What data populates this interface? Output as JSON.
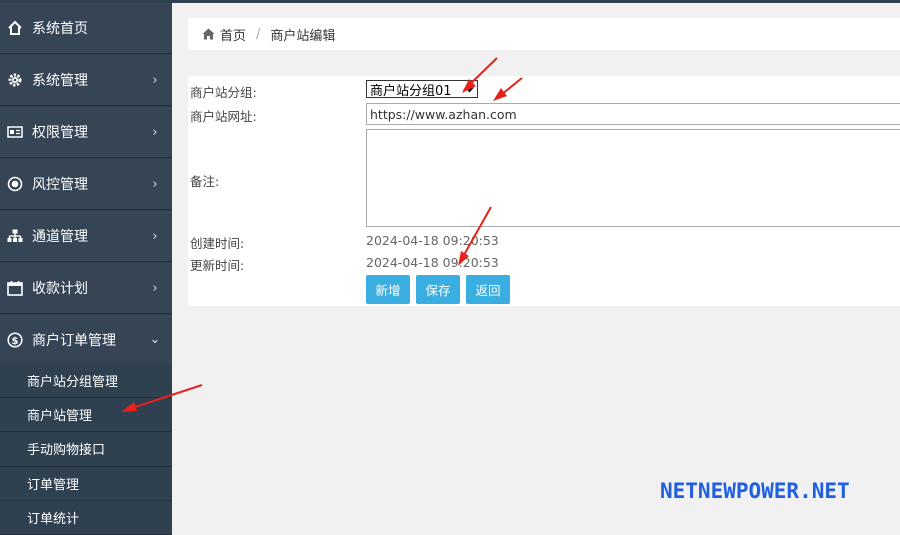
{
  "sidebar": {
    "items": [
      {
        "label": "系统首页",
        "icon": "home-icon",
        "arrow": ""
      },
      {
        "label": "系统管理",
        "icon": "gear-icon",
        "arrow": "›"
      },
      {
        "label": "权限管理",
        "icon": "id-card-icon",
        "arrow": "›"
      },
      {
        "label": "风控管理",
        "icon": "record-icon",
        "arrow": "›"
      },
      {
        "label": "通道管理",
        "icon": "sitemap-icon",
        "arrow": "›"
      },
      {
        "label": "收款计划",
        "icon": "calendar-icon",
        "arrow": "›"
      },
      {
        "label": "商户订单管理",
        "icon": "dollar-icon",
        "arrow": "⌄"
      }
    ],
    "sub_items": [
      "商户站分组管理",
      "商户站管理",
      "手动购物接口",
      "订单管理",
      "订单统计"
    ]
  },
  "breadcrumb": {
    "home": "首页",
    "separator": "/",
    "current": "商户站编辑"
  },
  "form": {
    "group_label": "商户站分组:",
    "group_value": "商户站分组01",
    "url_label": "商户站网址:",
    "url_value": "https://www.azhan.com",
    "remark_label": "备注:",
    "remark_value": "",
    "created_label": "创建时间:",
    "created_value": "2024-04-18 09:20:53",
    "updated_label": "更新时间:",
    "updated_value": "2024-04-18 09:20:53"
  },
  "buttons": {
    "add": "新增",
    "save": "保存",
    "back": "返回"
  },
  "watermark": "NETNEWPOWER.NET",
  "colors": {
    "sidebar": "#2f4050",
    "button": "#3aaee0",
    "annotation": "#e8211b",
    "watermark": "#1f5fe0"
  }
}
